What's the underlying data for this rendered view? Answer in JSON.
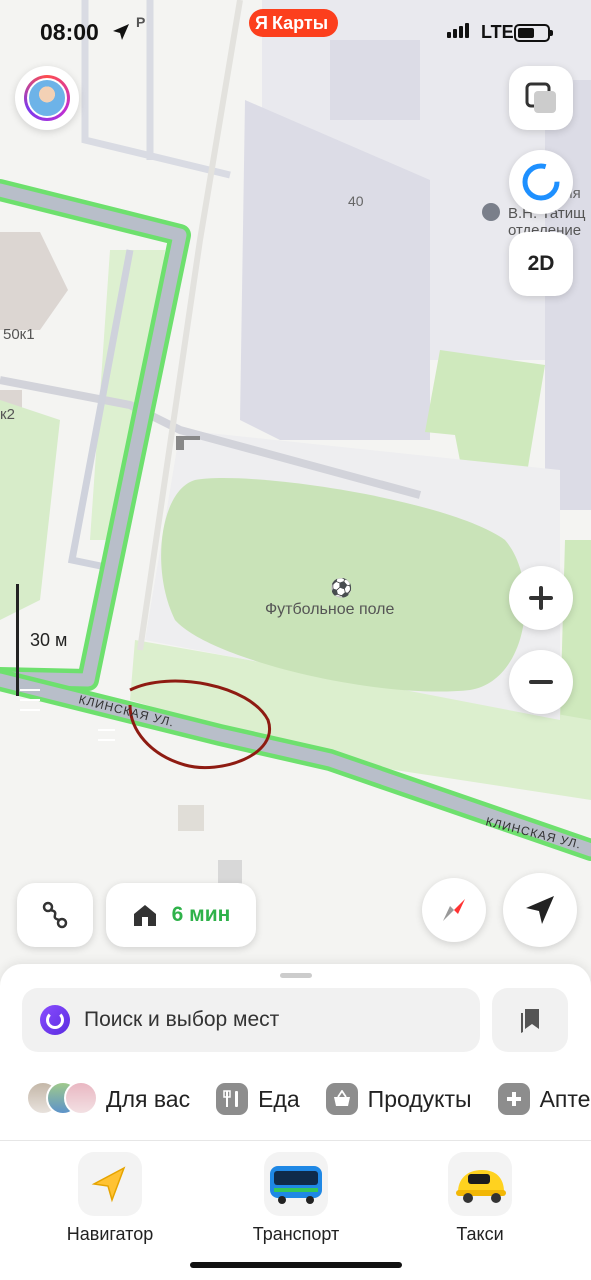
{
  "status_bar": {
    "time": "08:00",
    "app_indicator": "P",
    "brand_letter": "Я",
    "brand_name": "Карты",
    "network": "LTE"
  },
  "map": {
    "labels": {
      "building_40": "40",
      "building_50k1": "50к1",
      "building_k2": "к2",
      "poi_partial_1": "Гимназия",
      "poi_partial_2": "В.Н. Татищ",
      "poi_partial_3": "отделение",
      "field": "Футбольное поле",
      "street_1": "КЛИНСКАЯ УЛ.",
      "street_2": "КЛИНСКАЯ УЛ."
    },
    "scale": "30 м"
  },
  "controls": {
    "btn_2d": "2D",
    "route_eta": "6 мин"
  },
  "sheet": {
    "search_placeholder": "Поиск и выбор мест",
    "categories": [
      "Для вас",
      "Еда",
      "Продукты",
      "Аптеки"
    ],
    "tabs": [
      "Навигатор",
      "Транспорт",
      "Такси"
    ]
  },
  "colors": {
    "brand": "#fc3f1d",
    "route_green": "#2fb24a",
    "alice_purple": "#7c3aed"
  },
  "icons": [
    "location-arrow-icon",
    "layers-icon",
    "alice-icon",
    "plus-icon",
    "minus-icon",
    "route-icon",
    "home-icon",
    "compass-icon",
    "locate-icon",
    "bookmarks-icon",
    "fork-knife-icon",
    "basket-icon",
    "pharmacy-icon",
    "navigator-icon",
    "bus-icon",
    "taxi-icon"
  ]
}
